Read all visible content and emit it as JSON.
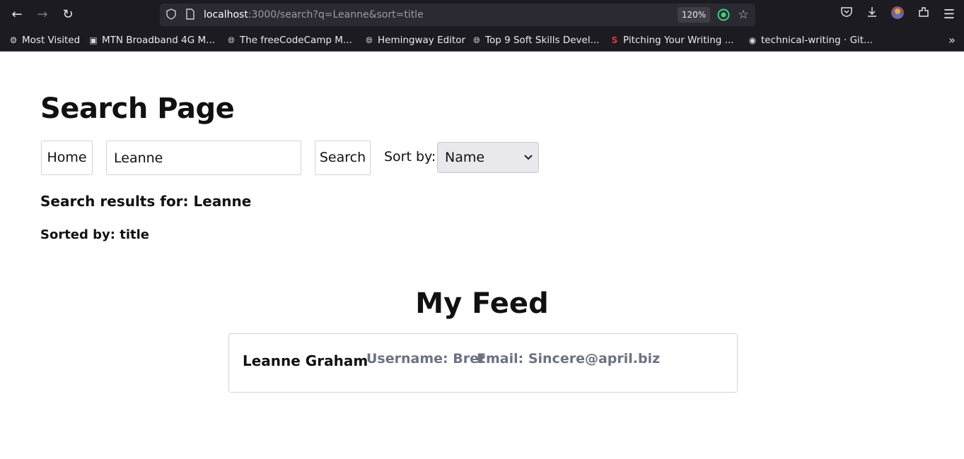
{
  "browser": {
    "url_host": "localhost",
    "url_rest": ":3000/search?q=Leanne&sort=title",
    "zoom": "120%",
    "icons": [
      "back-icon",
      "forward-icon",
      "reload-icon",
      "shield-icon",
      "page-icon",
      "star-icon",
      "pocket-icon",
      "download-icon",
      "extensions-icon",
      "menu-icon"
    ]
  },
  "bookmarks": [
    {
      "label": "Most Visited",
      "icon": "gear-icon"
    },
    {
      "label": "MTN Broadband 4G M...",
      "icon": "router-icon"
    },
    {
      "label": "The freeCodeCamp M...",
      "icon": "globe-icon"
    },
    {
      "label": "Hemingway Editor",
      "icon": "globe-icon"
    },
    {
      "label": "Top 9 Soft Skills Devel...",
      "icon": "globe-icon"
    },
    {
      "label": "Pitching Your Writing ...",
      "icon": "s-logo-icon"
    },
    {
      "label": "technical-writing · Git...",
      "icon": "github-icon"
    }
  ],
  "page": {
    "title": "Search Page",
    "home_button": "Home",
    "search_value": "Leanne",
    "search_button": "Search",
    "sort_label": "Sort by:",
    "sort_selected": "Name",
    "results_for": "Search results for: Leanne",
    "sorted_by": "Sorted by: title"
  },
  "feed": {
    "title": "My Feed",
    "users": [
      {
        "name": "Leanne Graham",
        "username": "Username: Bret",
        "email": "Email: Sincere@april.biz"
      }
    ]
  }
}
